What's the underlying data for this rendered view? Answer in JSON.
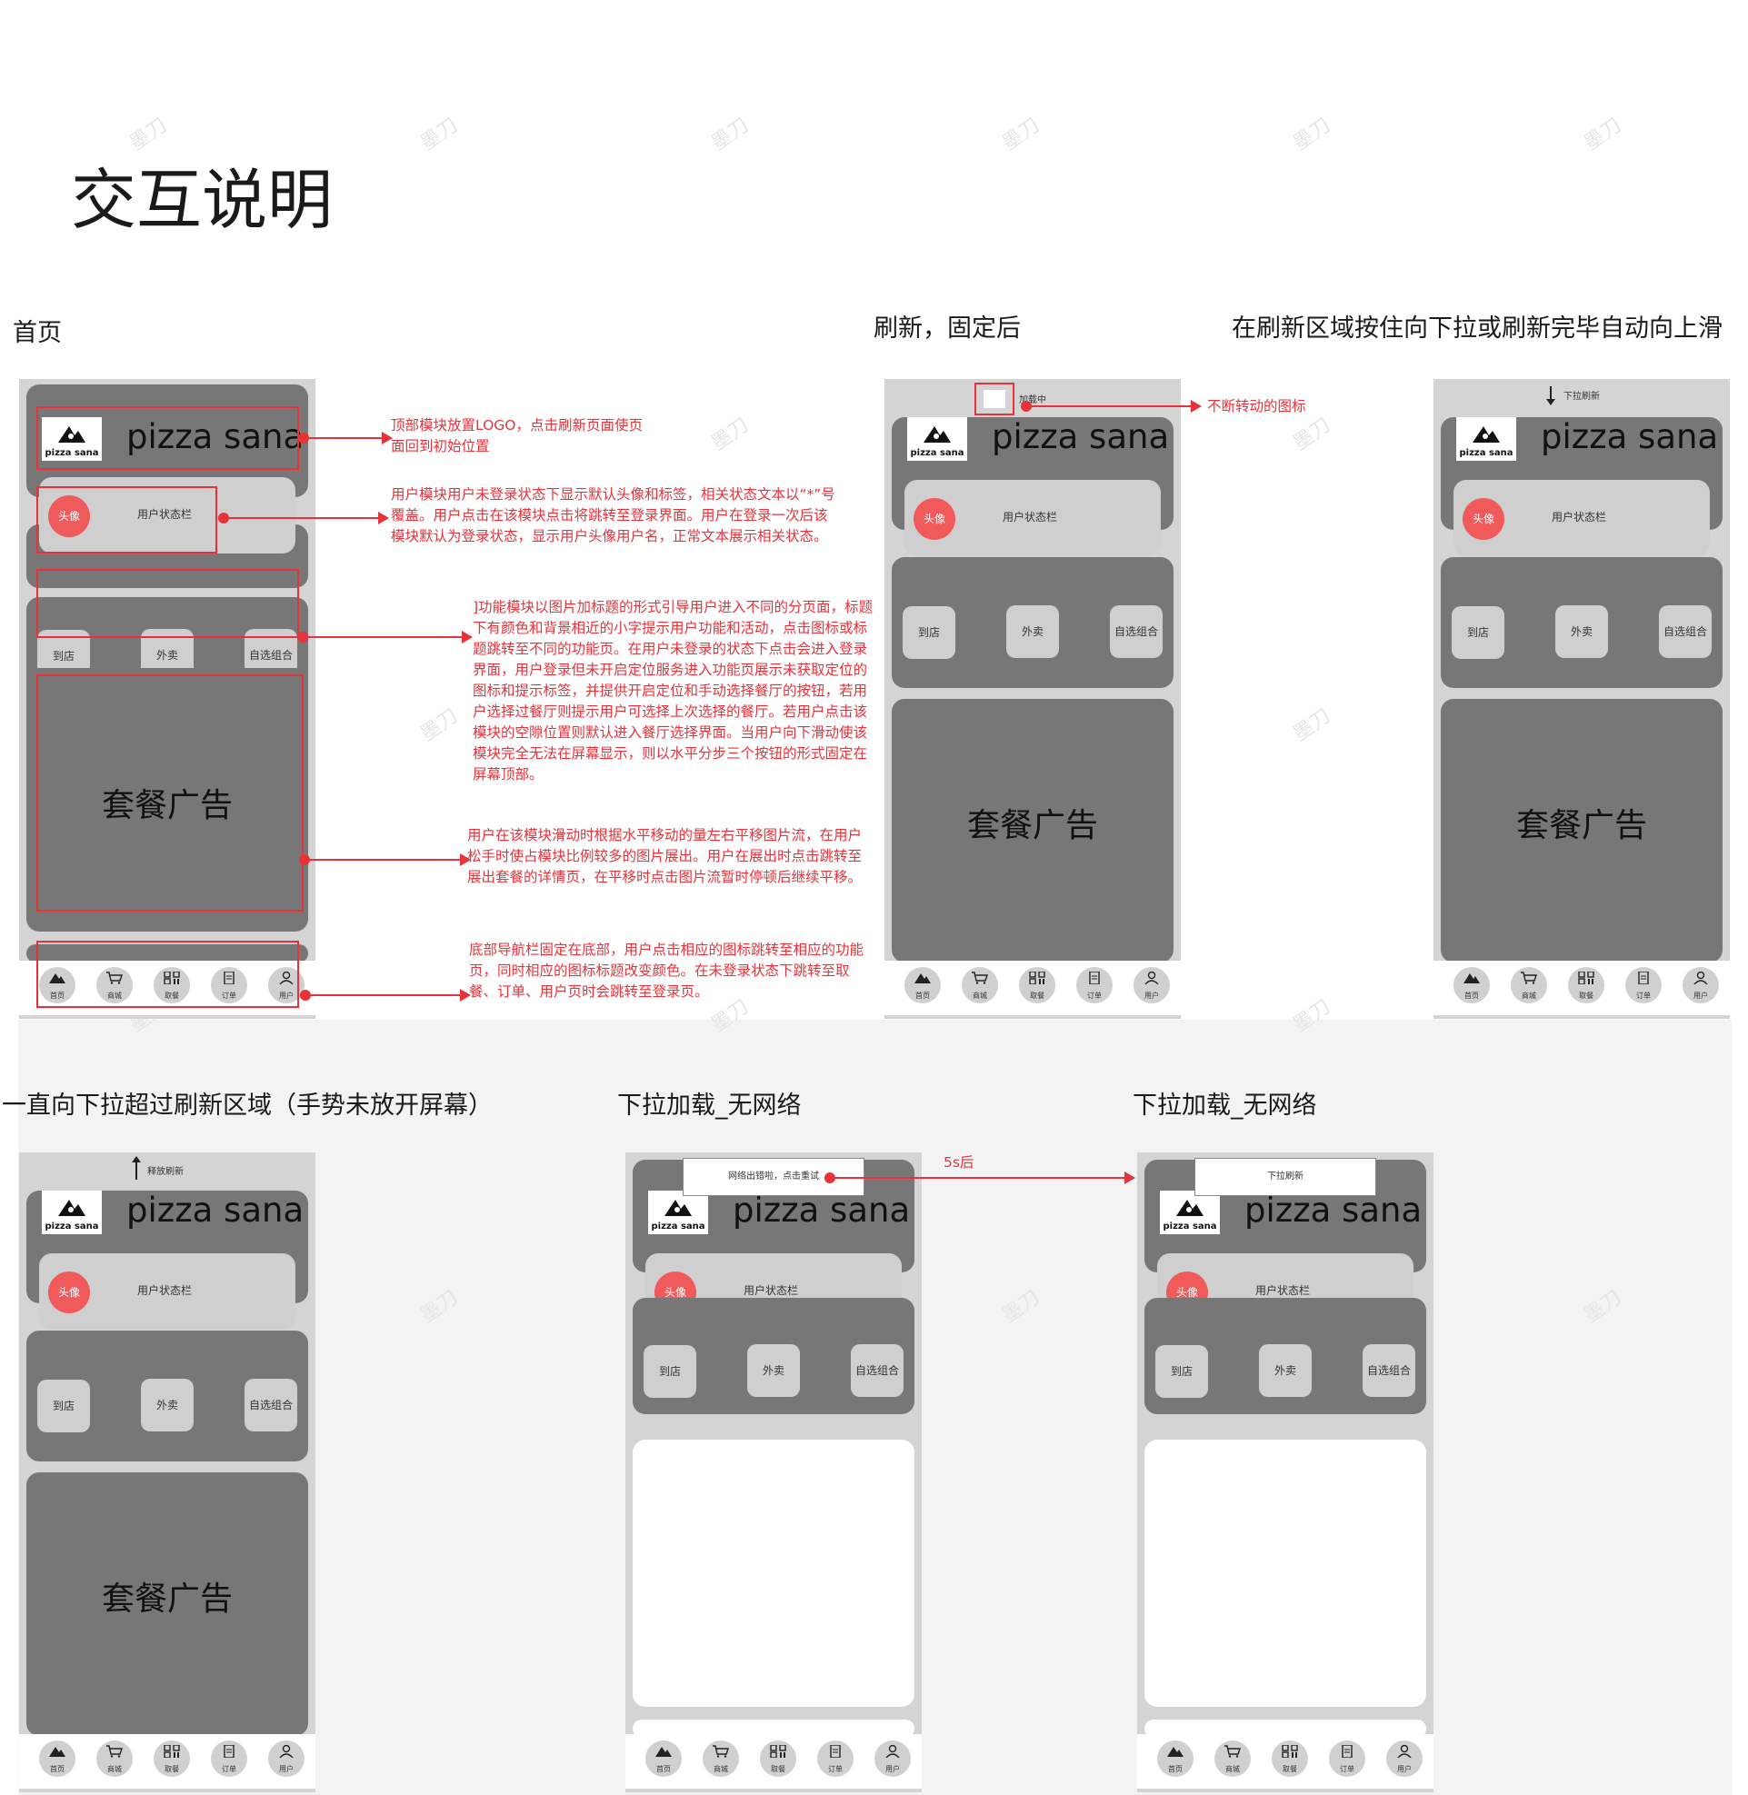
{
  "page_title": "交互说明",
  "sections": {
    "home": "首页",
    "refresh_fixed": "刷新，固定后",
    "pull_hold": "在刷新区域按住向下拉或刷新完毕自动向上滑",
    "pull_over": "一直向下拉超过刷新区域（手势未放开屏幕）",
    "no_network_1": "下拉加载_无网络",
    "no_network_2": "下拉加载_无网络"
  },
  "app": {
    "brand": "pizza sana",
    "logo_text": "pizza sana",
    "avatar": "头像",
    "user_status": "用户状态栏",
    "func_buttons": [
      "到店",
      "外卖",
      "自选组合"
    ],
    "ad": "套餐广告",
    "tabs": [
      "首页",
      "商城",
      "取餐",
      "订单",
      "用户"
    ]
  },
  "status_texts": {
    "loading": "加载中",
    "pull_to_refresh": "下拉刷新",
    "release_to_refresh": "释放刷新",
    "network_error": "网络出错啦，点击重试",
    "pull_refresh_toast": "下拉刷新"
  },
  "annotations": {
    "logo": "顶部模块放置LOGO，点击刷新页面使页面回到初始位置",
    "user": "用户模块用户未登录状态下显示默认头像和标签，相关状态文本以“*”号覆盖。用户点击在该模块点击将跳转至登录界面。用户在登录一次后该模块默认为登录状态，显示用户头像用户名，正常文本展示相关状态。",
    "func": "]功能模块以图片加标题的形式引导用户进入不同的分页面，标题下有颜色和背景相近的小字提示用户功能和活动，点击图标或标题跳转至不同的功能页。在用户未登录的状态下点击会进入登录界面，用户登录但未开启定位服务进入功能页展示未获取定位的图标和提示标签，并提供开启定位和手动选择餐厅的按钮，若用户选择过餐厅则提示用户可选择上次选择的餐厅。若用户点击该模块的空隙位置则默认进入餐厅选择界面。当用户向下滑动使该模块完全无法在屏幕显示，则以水平分步三个按钮的形式固定在屏幕顶部。",
    "ad": "用户在该模块滑动时根据水平移动的量左右平移图片流，在用户松手时使占模块比例较多的图片展出。用户在展出时点击跳转至展出套餐的详情页，在平移时点击图片流暂时停顿后继续平移。",
    "tabbar": "底部导航栏固定在底部，用户点击相应的图标跳转至相应的功能页，同时相应的图标标题改变颜色。在未登录状态下跳转至取餐、订单、用户页时会跳转至登录页。",
    "spinner": "不断转动的图标",
    "after_5s": "5s后"
  },
  "watermark": "墨刀",
  "colors": {
    "accent": "#e8323a",
    "avatar": "#f05a5a",
    "card_dark": "#777777",
    "card_light": "#cfcfcf"
  }
}
